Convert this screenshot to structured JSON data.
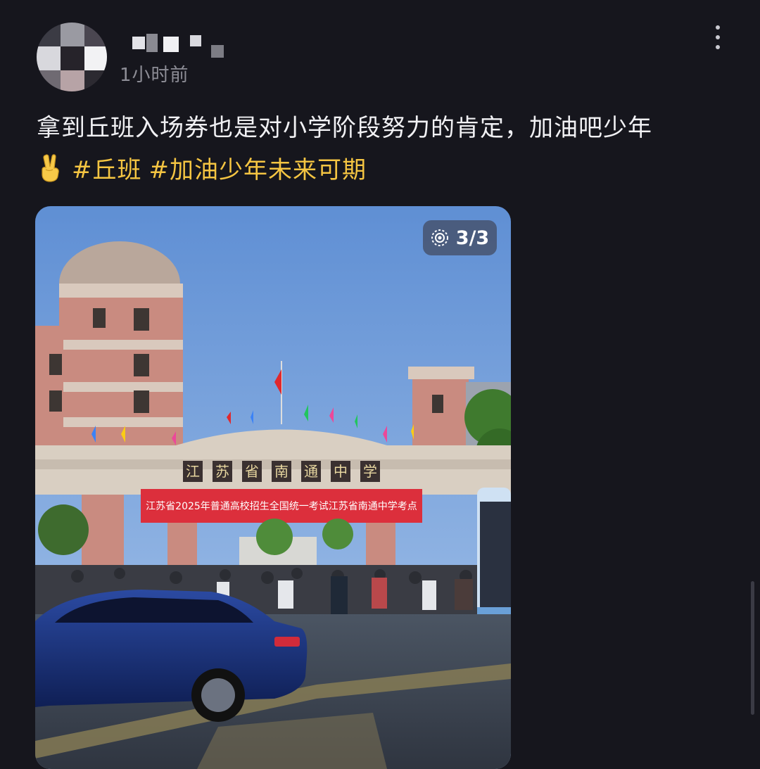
{
  "post": {
    "timestamp": "1小时前",
    "text_line1": "拿到丘班入场券也是对小学阶段努力的肯定，加油吧少年",
    "emoji": "victory-hand",
    "hashtags": [
      "#丘班",
      "#加油少年未来可期"
    ]
  },
  "photo": {
    "counter": "3/3",
    "gate_characters": [
      "江",
      "苏",
      "省",
      "南",
      "通",
      "中",
      "学"
    ],
    "banner_text": "江苏省2025年普通高校招生全国统一考试江苏省南通中学考点"
  },
  "icons": {
    "more": "more-vertical-icon",
    "counter": "gallery-icon"
  },
  "colors": {
    "background": "#16161d",
    "hashtag": "#f5c542",
    "timestamp": "#8d8d96"
  }
}
